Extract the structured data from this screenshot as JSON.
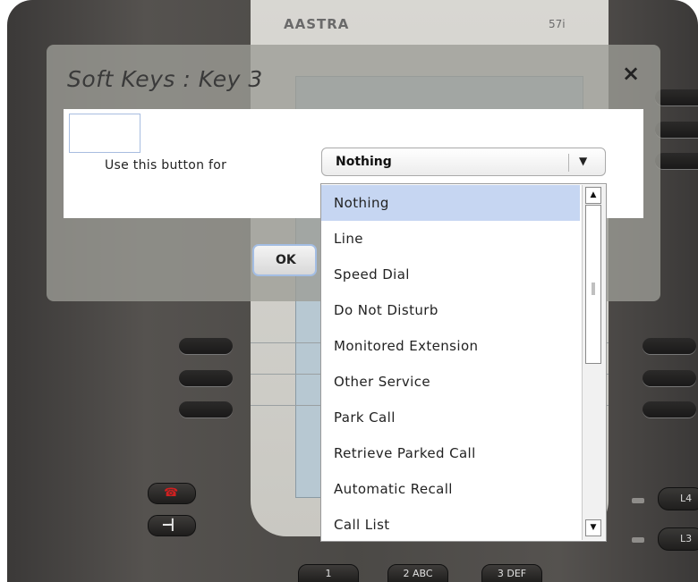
{
  "phone": {
    "brand": "AASTRA",
    "model": "57i",
    "line_keys": [
      "L4",
      "L3"
    ],
    "digit_keys": [
      "1",
      "2 ABC",
      "3 DEF"
    ]
  },
  "dialog": {
    "title": "Soft Keys : Key 3",
    "close_label": "×",
    "field_label": "Use this button for",
    "select_value": "Nothing",
    "ok_label": "OK"
  },
  "dropdown": {
    "selected_index": 0,
    "options": [
      "Nothing",
      "Line",
      "Speed Dial",
      "Do Not Disturb",
      "Monitored Extension",
      "Other Service",
      "Park Call",
      "Retrieve Parked Call",
      "Automatic Recall",
      "Call List"
    ]
  },
  "colors": {
    "selection": "#c6d6f2",
    "dialog_overlay": "#9c9c96",
    "ok_border": "#a3bde3"
  }
}
